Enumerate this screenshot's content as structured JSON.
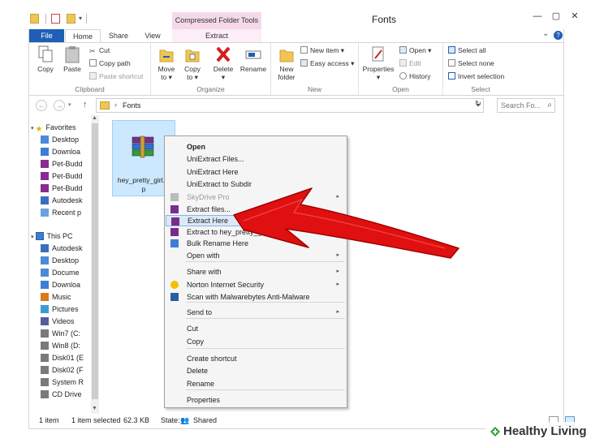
{
  "window": {
    "title": "Fonts",
    "contextual_tab_header": "Compressed Folder Tools",
    "minimize": "—",
    "maximize": "▢",
    "close": "✕"
  },
  "ribbon_tabs": {
    "file": "File",
    "home": "Home",
    "share": "Share",
    "view": "View",
    "extract": "Extract"
  },
  "ribbon": {
    "clipboard": {
      "label": "Clipboard",
      "copy": "Copy",
      "paste": "Paste",
      "cut": "Cut",
      "copy_path": "Copy path",
      "paste_shortcut": "Paste shortcut"
    },
    "organize": {
      "label": "Organize",
      "move_to": "Move\nto",
      "move_to_l1": "Move",
      "move_to_l2": "to ▾",
      "copy_to_l1": "Copy",
      "copy_to_l2": "to ▾",
      "delete": "Delete",
      "delete_l2": "▾",
      "rename": "Rename"
    },
    "new": {
      "label": "New",
      "new_folder_l1": "New",
      "new_folder_l2": "folder",
      "new_item": "New item ▾",
      "easy_access": "Easy access ▾"
    },
    "open": {
      "label": "Open",
      "properties": "Properties",
      "properties_l2": "▾",
      "open": "Open ▾",
      "edit": "Edit",
      "history": "History"
    },
    "select": {
      "label": "Select",
      "select_all": "Select all",
      "select_none": "Select none",
      "invert_selection": "Invert selection"
    }
  },
  "address": {
    "path": "Fonts",
    "search_placeholder": "Search Fo..."
  },
  "nav": {
    "favorites": "Favorites",
    "items_fav": [
      "Desktop",
      "Downloa",
      "Pet-Budd",
      "Pet-Budd",
      "Pet-Budd",
      "Autodesk",
      "Recent p"
    ],
    "this_pc": "This PC",
    "items_pc": [
      "Autodesk",
      "Desktop",
      "Docume",
      "Downloa",
      "Music",
      "Pictures",
      "Videos",
      "Win7 (C:",
      "Win8 (D:",
      "Disk01 (E",
      "Disk02 (F",
      "System R",
      "CD Drive"
    ]
  },
  "file": {
    "name_line1": "hey_pretty_girl.zi",
    "name_line2": "p"
  },
  "context_menu": {
    "items": [
      {
        "label": "Open",
        "bold": true
      },
      {
        "label": "UniExtract Files..."
      },
      {
        "label": "UniExtract Here"
      },
      {
        "label": "UniExtract to Subdir"
      },
      {
        "label": "SkyDrive Pro",
        "disabled": true,
        "submenu": true
      },
      {
        "label": "Extract files..."
      },
      {
        "label": "Extract Here",
        "highlighted": true
      },
      {
        "label": "Extract to hey_pretty_girl\\"
      },
      {
        "label": "Bulk Rename Here"
      },
      {
        "label": "Open with",
        "submenu": true
      },
      {
        "label": "Share with",
        "submenu": true
      },
      {
        "label": "Norton Internet Security",
        "submenu": true
      },
      {
        "label": "Scan with Malwarebytes Anti-Malware"
      },
      {
        "label": "Send to",
        "submenu": true
      },
      {
        "label": "Cut"
      },
      {
        "label": "Copy"
      },
      {
        "label": "Create shortcut"
      },
      {
        "label": "Delete"
      },
      {
        "label": "Rename"
      },
      {
        "label": "Properties"
      }
    ]
  },
  "status": {
    "count": "1 item",
    "selected": "1 item selected",
    "size": "62.3 KB",
    "state_label": "State:",
    "state_value": "Shared"
  },
  "watermark": {
    "text": "Healthy Living"
  },
  "colors": {
    "accent": "#1f5fb5",
    "context_tab": "#f5d9ea",
    "selection": "#cce8ff",
    "arrow_red": "#e01010"
  }
}
